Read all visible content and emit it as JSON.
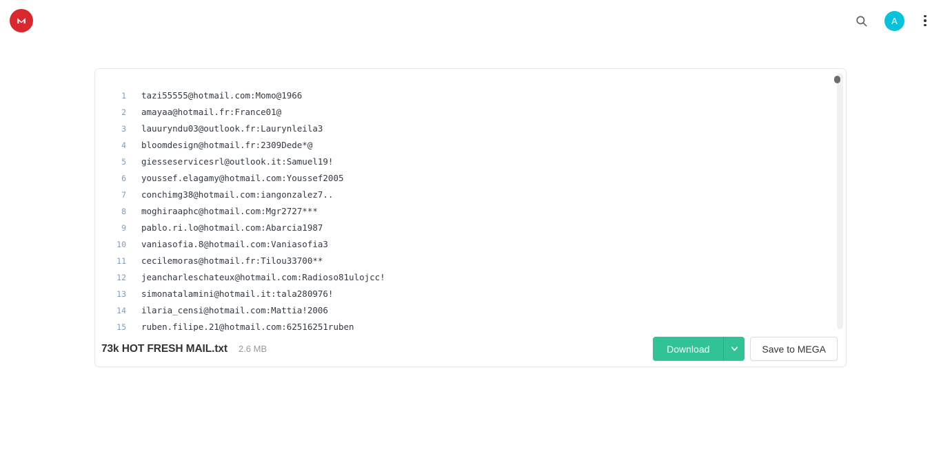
{
  "header": {
    "logo": {
      "name": "mega-logo",
      "letter": "M",
      "color": "#d9272e"
    },
    "search_icon": "search-icon",
    "avatar": {
      "initial": "A",
      "color": "#06c3db"
    },
    "menu_icon": "more-vertical-icon"
  },
  "viewer": {
    "lines": [
      {
        "num": "1",
        "text": "tazi55555@hotmail.com:Momo@1966"
      },
      {
        "num": "2",
        "text": "amayaa@hotmail.fr:France01@"
      },
      {
        "num": "3",
        "text": "lauuryndu03@outlook.fr:Laurynleila3"
      },
      {
        "num": "4",
        "text": "bloomdesign@hotmail.fr:2309Dede*@"
      },
      {
        "num": "5",
        "text": "giesseservicesrl@outlook.it:Samuel19!"
      },
      {
        "num": "6",
        "text": "youssef.elagamy@hotmail.com:Youssef2005"
      },
      {
        "num": "7",
        "text": "conchimg38@hotmail.com:iangonzalez7.."
      },
      {
        "num": "8",
        "text": "moghiraaphc@hotmail.com:Mgr2727***"
      },
      {
        "num": "9",
        "text": "pablo.ri.lo@hotmail.com:Abarcia1987"
      },
      {
        "num": "10",
        "text": "vaniasofia.8@hotmail.com:Vaniasofia3"
      },
      {
        "num": "11",
        "text": "cecilemoras@hotmail.fr:Tilou33700**"
      },
      {
        "num": "12",
        "text": "jeancharleschateux@hotmail.com:Radioso81ulojcc!"
      },
      {
        "num": "13",
        "text": "simonatalamini@hotmail.it:tala280976!"
      },
      {
        "num": "14",
        "text": "ilaria_censi@hotmail.com:Mattia!2006"
      },
      {
        "num": "15",
        "text": "ruben.filipe.21@hotmail.com:62516251ruben"
      }
    ]
  },
  "footer": {
    "file_name": "73k HOT FRESH MAIL.txt",
    "file_size": "2.6 MB",
    "download_label": "Download",
    "download_dropdown_icon": "chevron-down-icon",
    "save_label": "Save to MEGA",
    "accent_green": "#31c395"
  }
}
